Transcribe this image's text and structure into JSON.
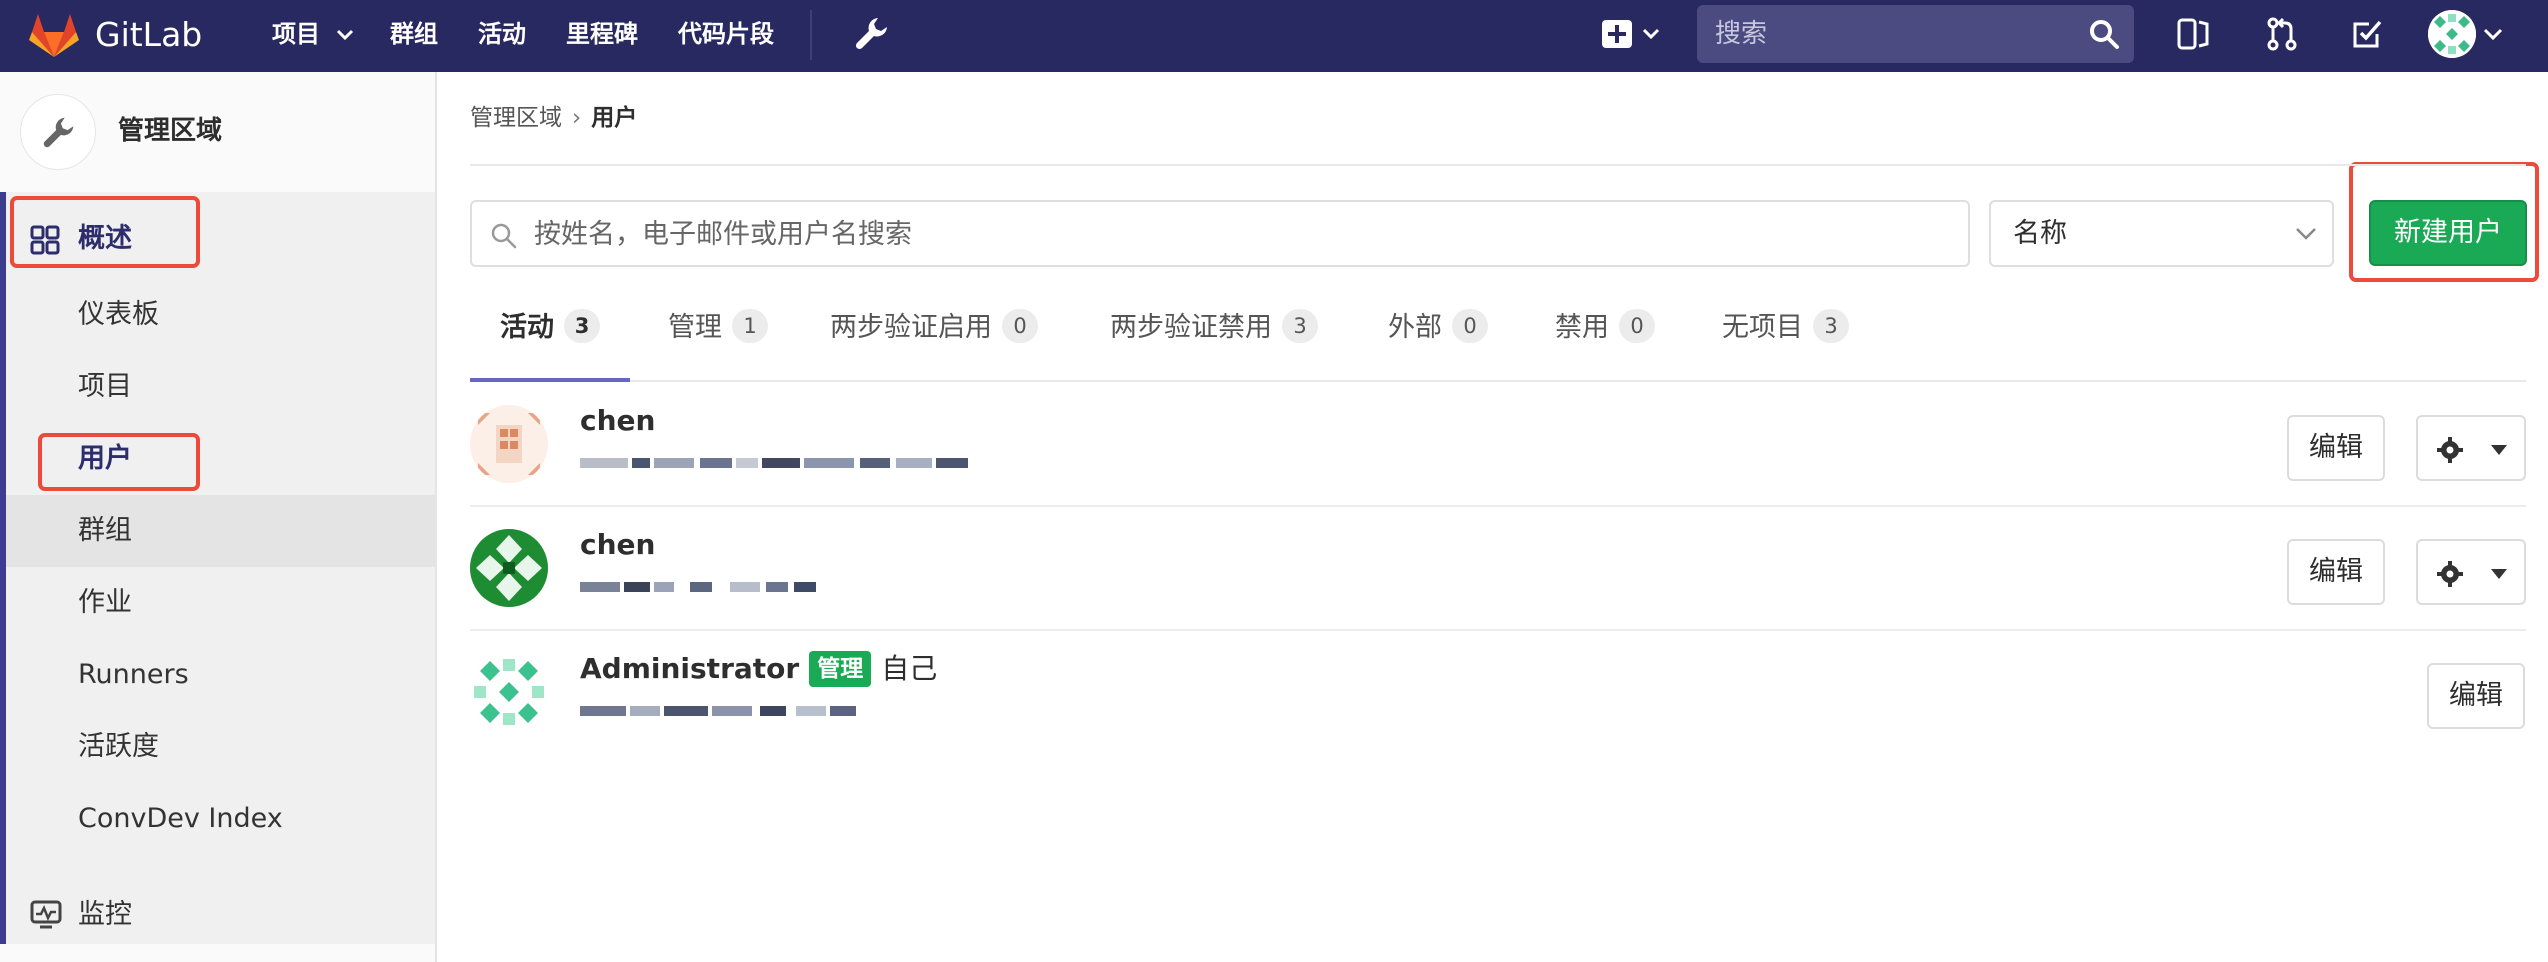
{
  "navbar": {
    "brand": "GitLab",
    "items": [
      {
        "label": "项目",
        "has_dropdown": true
      },
      {
        "label": "群组"
      },
      {
        "label": "活动"
      },
      {
        "label": "里程碑"
      },
      {
        "label": "代码片段"
      }
    ],
    "search_placeholder": "搜索",
    "icons": [
      "wrench-icon",
      "plus-square-icon",
      "search-icon",
      "sidebar-toggle-icon",
      "merge-request-icon",
      "todo-check-icon",
      "avatar"
    ]
  },
  "sidebar": {
    "context_title": "管理区域",
    "top_item": {
      "label": "概述",
      "icon": "grid-icon"
    },
    "sub_items": [
      {
        "label": "仪表板"
      },
      {
        "label": "项目"
      },
      {
        "label": "用户",
        "active": true
      },
      {
        "label": "群组"
      },
      {
        "label": "作业"
      },
      {
        "label": "Runners"
      },
      {
        "label": "活跃度"
      },
      {
        "label": "ConvDev Index"
      }
    ],
    "monitor": {
      "label": "监控",
      "icon": "monitor-icon"
    }
  },
  "breadcrumb": {
    "parent": "管理区域",
    "separator": "›",
    "current": "用户"
  },
  "filters": {
    "search_placeholder": "按姓名，电子邮件或用户名搜索",
    "sort_value": "名称",
    "new_user_label": "新建用户"
  },
  "tabs": [
    {
      "label": "活动",
      "count": "3",
      "active": true
    },
    {
      "label": "管理",
      "count": "1"
    },
    {
      "label": "两步验证启用",
      "count": "0"
    },
    {
      "label": "两步验证禁用",
      "count": "3"
    },
    {
      "label": "外部",
      "count": "0"
    },
    {
      "label": "禁用",
      "count": "0"
    },
    {
      "label": "无项目",
      "count": "3"
    }
  ],
  "users": [
    {
      "name": "chen",
      "edit_label": "编辑",
      "has_settings": true
    },
    {
      "name": "chen",
      "edit_label": "编辑",
      "has_settings": true
    },
    {
      "name": "Administrator",
      "badge": "管理",
      "self_label": "自己",
      "edit_label": "编辑",
      "has_settings": false
    }
  ],
  "colors": {
    "navbar_bg": "#292961",
    "accent": "#6666c4",
    "success": "#1aaa55",
    "annotation": "#ec4a3b"
  }
}
